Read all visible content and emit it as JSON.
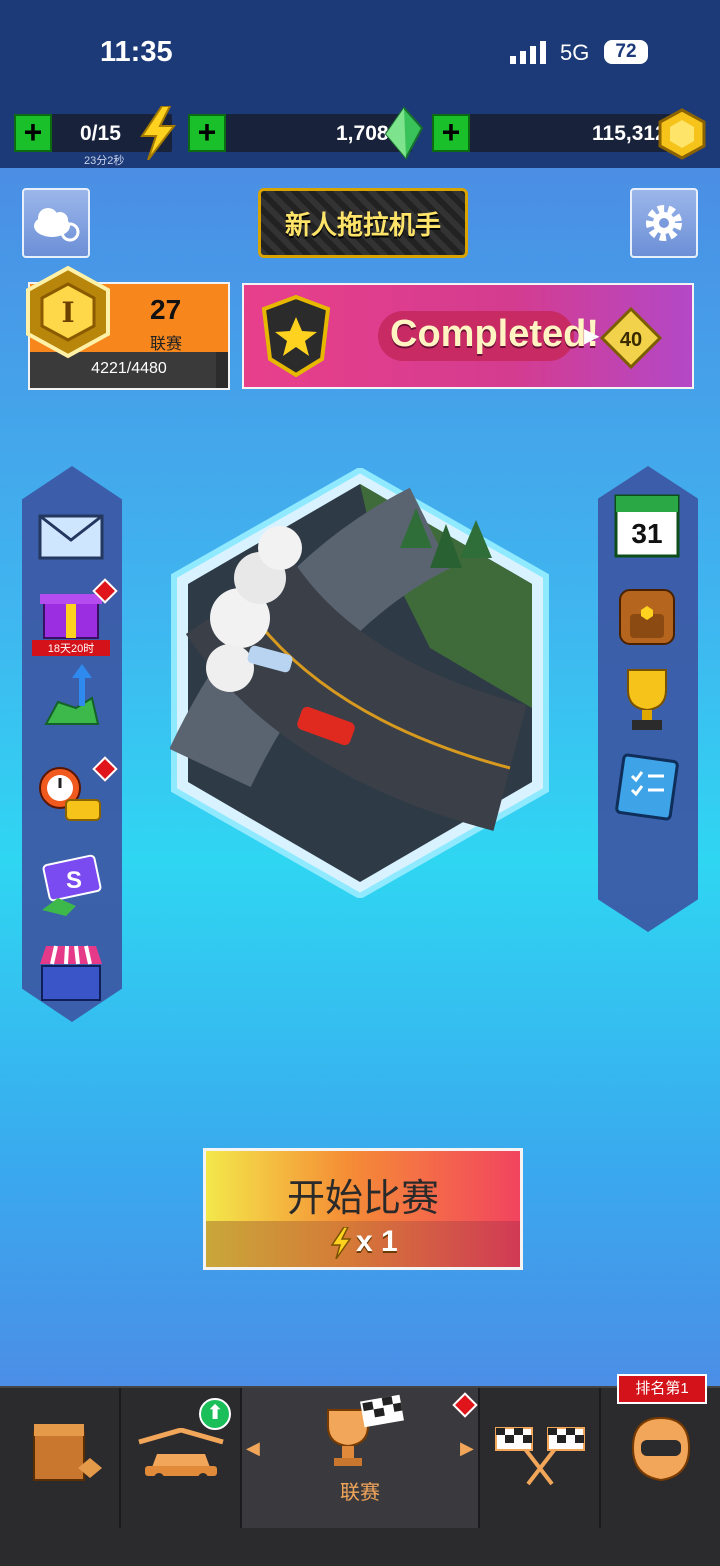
{
  "status_bar": {
    "time": "11:35",
    "network": "5G",
    "battery": "72"
  },
  "currency": {
    "energy": {
      "value": "0/15",
      "timer": "23分2秒"
    },
    "gems": {
      "value": "1,708"
    },
    "coins": {
      "value": "115,312"
    }
  },
  "header": {
    "rank_title": "新人拖拉机手"
  },
  "league": {
    "level_roman": "I",
    "number": "27",
    "label": "联赛",
    "progress": "4221/4480",
    "progress_fraction": 0.942
  },
  "event_banner": {
    "text": "Completed!",
    "reward": "40"
  },
  "left_menu": {
    "gift_timer": "18天20时"
  },
  "right_menu": {
    "calendar_day": "31"
  },
  "start_button": {
    "label": "开始比赛",
    "cost": "x 1"
  },
  "bottom_nav": {
    "league_label": "联赛",
    "rank_badge": "排名第1"
  },
  "colors": {
    "accent_green": "#19c02a",
    "nav_bg": "#2b2b2e",
    "league_orange": "#f7871d",
    "alert_red": "#e0141b"
  }
}
